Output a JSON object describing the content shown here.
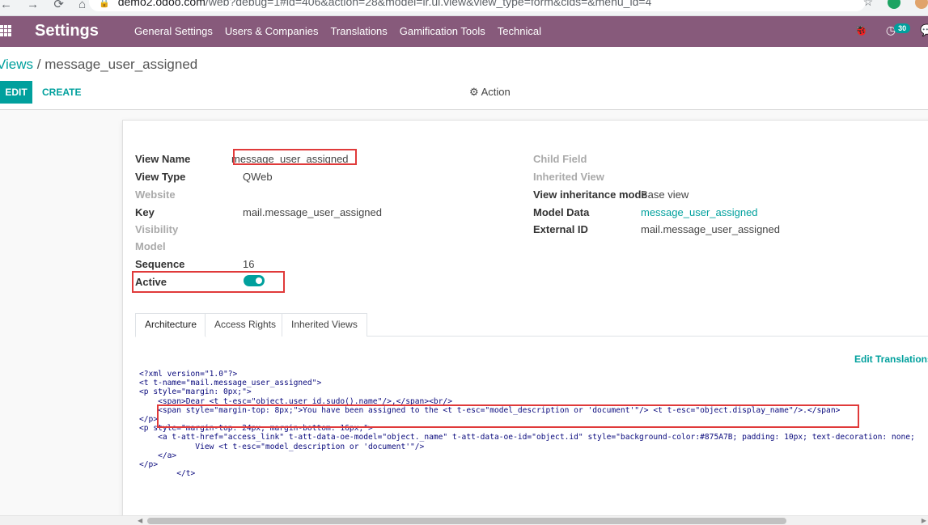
{
  "browser": {
    "back": "←",
    "forward": "→",
    "reload": "⟳",
    "home": "⌂",
    "url_host": "demo2.odoo.com",
    "url_path": "/web?debug=1#id=406&action=28&model=ir.ui.view&view_type=form&cids=&menu_id=4",
    "star": "☆"
  },
  "topnav": {
    "app_title": "Settings",
    "menu": [
      "General Settings",
      "Users & Companies",
      "Translations",
      "Gamification Tools",
      "Technical"
    ],
    "bug_icon": "🐞",
    "chat_badge": "30"
  },
  "control_panel": {
    "breadcrumb_parent": "Views",
    "breadcrumb_sep": " / ",
    "breadcrumb_current": "message_user_assigned",
    "edit_label": "EDIT",
    "create_label": "CREATE",
    "action_label": "Action"
  },
  "form": {
    "left": [
      {
        "label": "View Name",
        "value": "message_user_assigned",
        "muted": false
      },
      {
        "label": "View Type",
        "value": "QWeb",
        "muted": false
      },
      {
        "label": "Website",
        "value": "",
        "muted": true
      },
      {
        "label": "Key",
        "value": "mail.message_user_assigned",
        "muted": false
      },
      {
        "label": "Visibility",
        "value": "",
        "muted": true
      },
      {
        "label": "Model",
        "value": "",
        "muted": true
      },
      {
        "label": "Sequence",
        "value": "16",
        "muted": false
      },
      {
        "label": "Active",
        "value": "",
        "muted": false
      }
    ],
    "right": [
      {
        "label": "Child Field",
        "value": "",
        "muted": true
      },
      {
        "label": "Inherited View",
        "value": "",
        "muted": true
      },
      {
        "label": "View inheritance mode",
        "value": "Base view",
        "muted": false
      },
      {
        "label": "Model Data",
        "value": "message_user_assigned",
        "muted": false,
        "link": true
      },
      {
        "label": "External ID",
        "value": "mail.message_user_assigned",
        "muted": false
      }
    ],
    "active": true
  },
  "tabs": [
    "Architecture",
    "Access Rights",
    "Inherited Views"
  ],
  "edit_translations": "Edit Translations",
  "code_lines": [
    "<?xml version=\"1.0\"?>",
    "<t t-name=\"mail.message_user_assigned\">",
    "<p style=\"margin: 0px;\">",
    "    <span>Dear <t t-esc=\"object.user_id.sudo().name\"/>,</span><br/>",
    "    <span style=\"margin-top: 8px;\">You have been assigned to the <t t-esc=\"model_description or 'document'\"/> <t t-esc=\"object.display_name\"/>.</span>",
    "</p>",
    "<p style=\"margin-top: 24px; margin-bottom: 16px;\">",
    "    <a t-att-href=\"access_link\" t-att-data-oe-model=\"object._name\" t-att-data-oe-id=\"object.id\" style=\"background-color:#875A7B; padding: 10px; text-decoration: none;",
    "            View <t t-esc=\"model_description or 'document'\"/>",
    "    </a>",
    "</p>",
    "        </t>"
  ],
  "colors": {
    "brand": "#875a7b",
    "accent": "#00a09d",
    "highlight": "#e03a3a"
  }
}
